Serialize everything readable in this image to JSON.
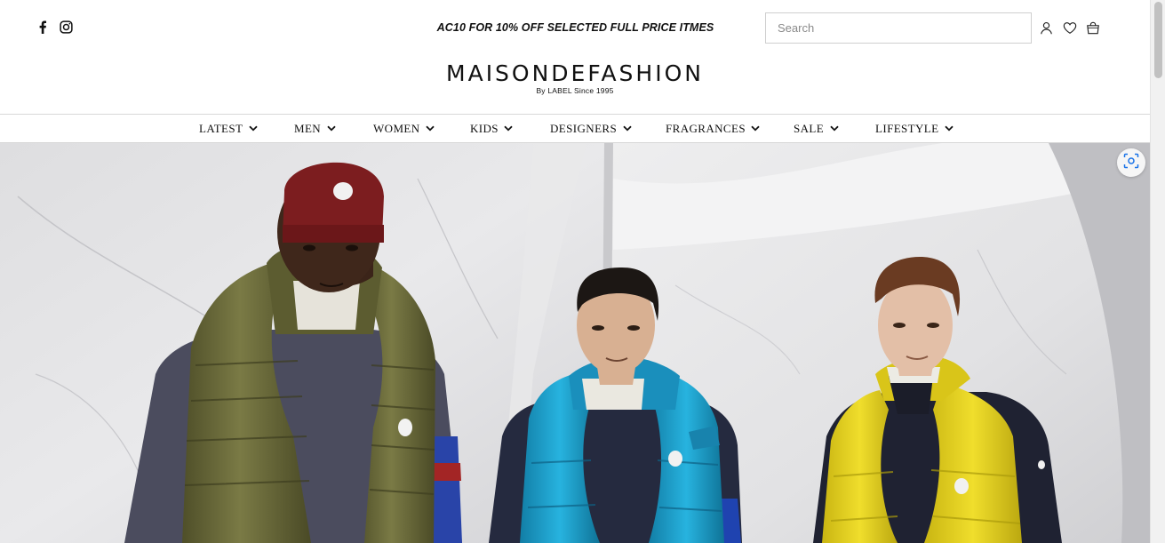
{
  "header": {
    "social": [
      {
        "icon": "facebook-icon"
      },
      {
        "icon": "instagram-icon"
      }
    ],
    "promo_text": "AC10 FOR 10% OFF SELECTED FULL PRICE ITMES",
    "search": {
      "placeholder": "Search",
      "value": ""
    },
    "icons": [
      "account-icon",
      "wishlist-heart-icon",
      "shopping-bag-icon"
    ],
    "logo": {
      "title": "MAISONDEFASHION",
      "subtitle": "By LABEL Since 1995"
    }
  },
  "nav": {
    "items": [
      {
        "label": "LATEST"
      },
      {
        "label": "MEN"
      },
      {
        "label": "WOMEN"
      },
      {
        "label": "KIDS"
      },
      {
        "label": "DESIGNERS"
      },
      {
        "label": "FRAGRANCES"
      },
      {
        "label": "SALE"
      },
      {
        "label": "LIFESTYLE"
      }
    ]
  },
  "hero": {
    "colors": {
      "marble": "#e4e4e6",
      "hat": "#7c1d1f",
      "olive_vest": "#6b6b3a",
      "blue_vest": "#1d9cc8",
      "yellow_vest": "#e6d21f",
      "navy": "#252a3f"
    }
  },
  "lens_button": {
    "icon": "visual-search-lens-icon"
  }
}
